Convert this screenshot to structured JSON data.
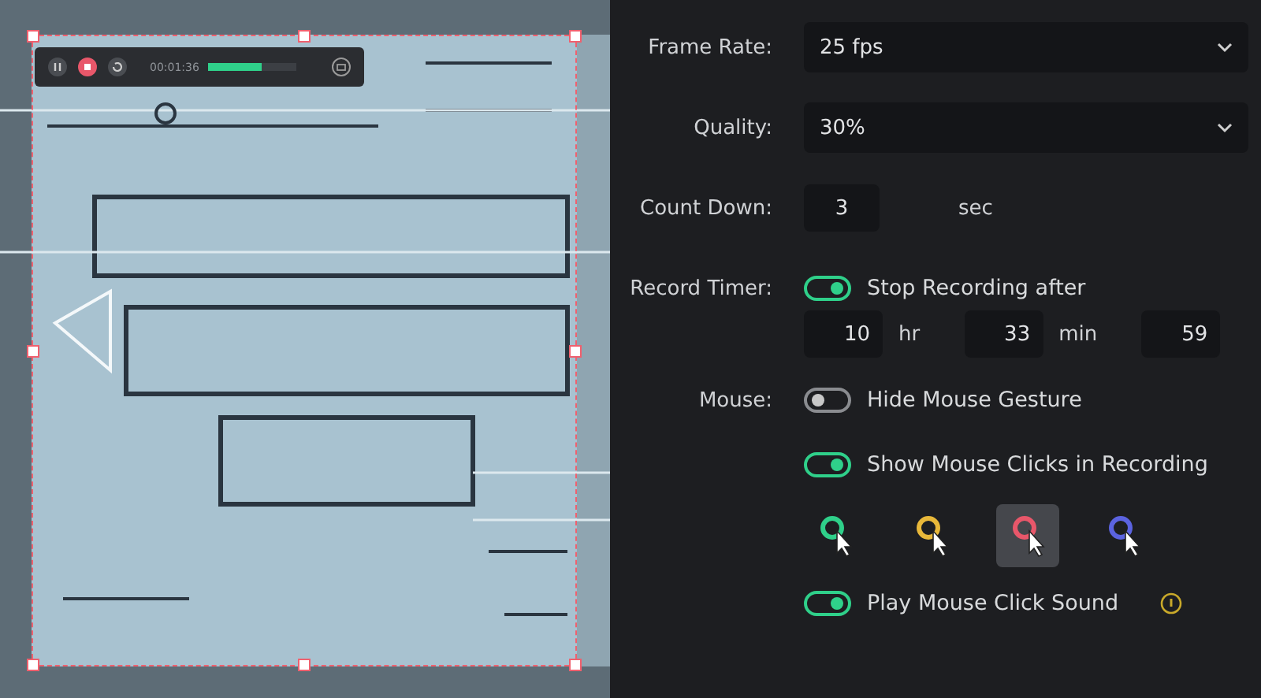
{
  "recorder": {
    "time": "00:01:36",
    "level": 0.6
  },
  "settings": [
    {
      "kind": "select",
      "label": "Frame Rate:",
      "value": "25 fps"
    },
    {
      "kind": "select",
      "label": "Quality:",
      "value": "30%"
    },
    {
      "kind": "number",
      "label": "Count Down:",
      "value": "3",
      "unit": "sec"
    },
    {
      "kind": "toggle",
      "label": "Record Timer:",
      "on": true,
      "text": "Stop Recording after"
    },
    {
      "kind": "timer",
      "fields": [
        {
          "value": "10",
          "unit": "hr"
        },
        {
          "value": "33",
          "unit": "min"
        },
        {
          "value": "59"
        }
      ]
    },
    {
      "kind": "toggle",
      "label": "Mouse:",
      "on": false,
      "text": "Hide Mouse Gesture"
    },
    {
      "kind": "toggle",
      "on": true,
      "text": "Show Mouse Clicks in Recording"
    },
    {
      "kind": "cursors",
      "items": [
        {
          "color": "#2fd08a",
          "selected": false
        },
        {
          "color": "#e8b83a",
          "selected": false
        },
        {
          "color": "#e8576a",
          "selected": true
        },
        {
          "color": "#5b63e0",
          "selected": false
        }
      ]
    },
    {
      "kind": "toggle",
      "on": true,
      "text": "Play Mouse Click Sound",
      "info": true
    }
  ]
}
